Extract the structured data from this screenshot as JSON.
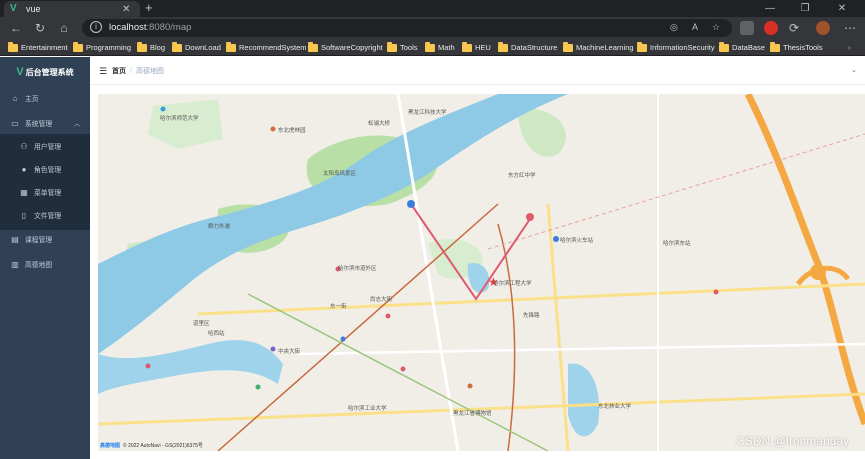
{
  "browser": {
    "tab_title": "vue",
    "url_host": "localhost",
    "url_rest": ":8080/map",
    "bookmarks": [
      "Entertainment",
      "Programming",
      "Blog",
      "DownLoad",
      "RecommendSystem",
      "SoftwareCopyright",
      "Tools",
      "Math",
      "HEU",
      "DataStructure",
      "MachineLearning",
      "InformationSecurity",
      "DataBase",
      "ThesisTools"
    ]
  },
  "sidebar": {
    "logo_text": "后台管理系统",
    "items": [
      {
        "label": "主页",
        "icon": "home-icon"
      },
      {
        "label": "系统管理",
        "icon": "setting-icon"
      },
      {
        "label": "用户管理",
        "icon": "user-icon"
      },
      {
        "label": "角色管理",
        "icon": "role-icon"
      },
      {
        "label": "菜单管理",
        "icon": "menu-icon"
      },
      {
        "label": "文件管理",
        "icon": "file-icon"
      },
      {
        "label": "课程管理",
        "icon": "course-icon"
      },
      {
        "label": "高德地图",
        "icon": "map-icon"
      }
    ]
  },
  "header": {
    "breadcrumb_home": "首页",
    "breadcrumb_current": "高德地图"
  },
  "map": {
    "labels": [
      "哈尔滨师范大学",
      "东北虎林园",
      "黑龙江科技大学",
      "松浦大桥",
      "哈尔滨市道外区",
      "东方红中学",
      "哈尔滨火车站",
      "哈尔滨工程大学",
      "先锋路",
      "尚志大街",
      "哈西站",
      "中央大街",
      "黑龙江省博物馆",
      "东北林业大学",
      "哈尔滨工业大学",
      "太阳岛风景区",
      "群力外滩",
      "东一街",
      "哈尔滨东站",
      "道里区"
    ],
    "attribution_logo": "高德地图",
    "attribution_text": "© 2022 AutoNavi - GS(2021)6375号"
  },
  "watermark": "CSDN @Ironmanday",
  "colors": {
    "sidebar_bg": "#304156",
    "river": "#8ecae6",
    "park": "#b7dfa6",
    "route": "#e05a6d"
  }
}
